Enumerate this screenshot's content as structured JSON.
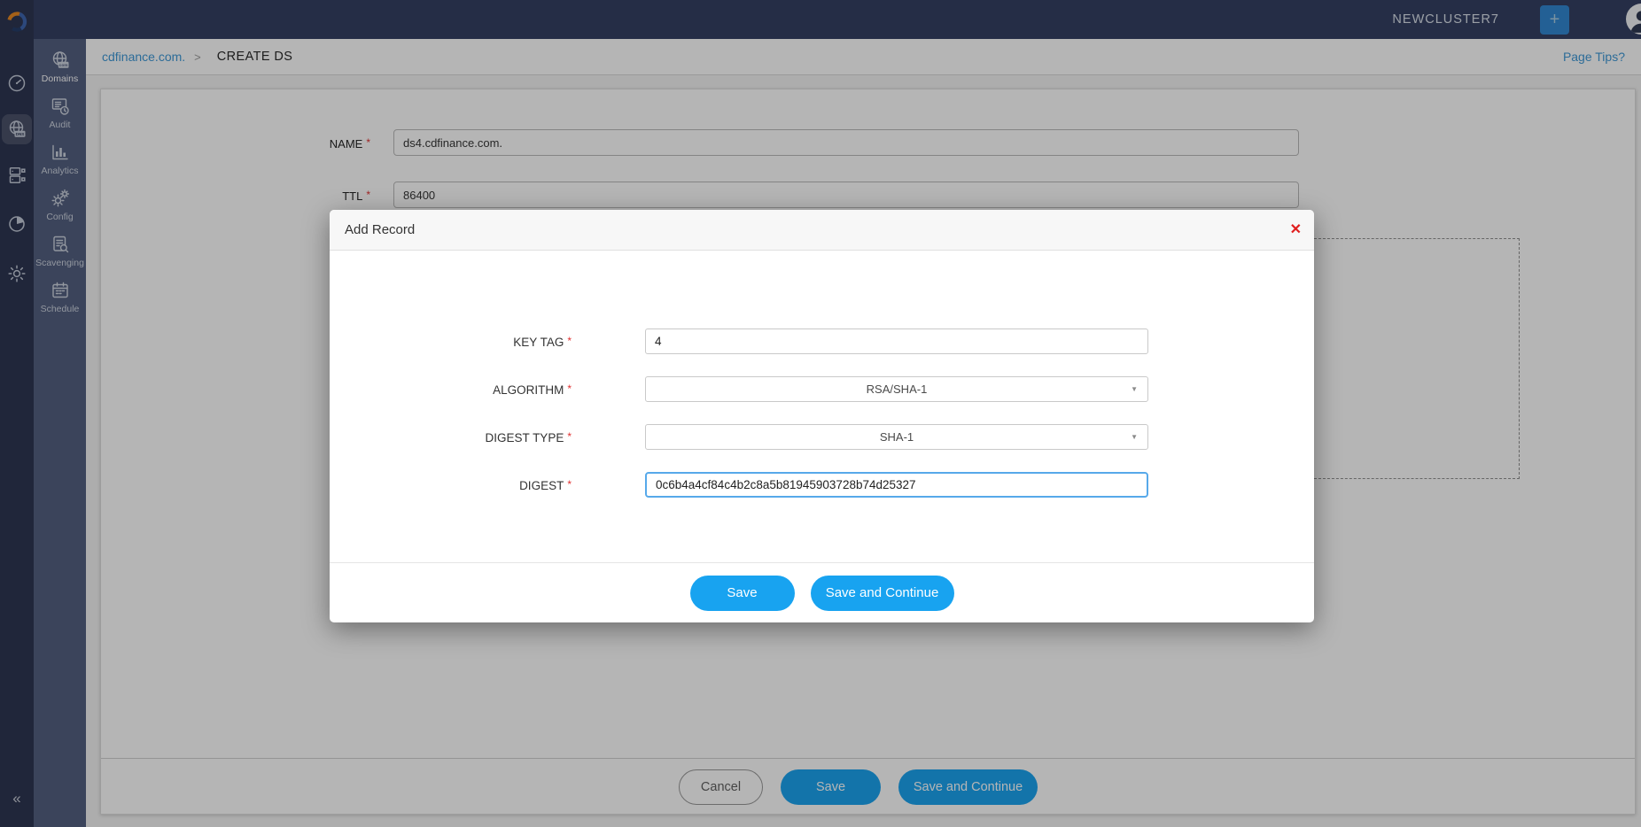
{
  "topbar": {
    "cluster_name": "NEWCLUSTER7",
    "add_button_label": "+",
    "avatar_icon": "user-avatar"
  },
  "sidebar_outer": {
    "logo_icon": "brand-swirl",
    "items": [
      {
        "icon": "dashboard-speedometer",
        "active": false
      },
      {
        "icon": "dns-globe",
        "active": true
      },
      {
        "icon": "server-devices",
        "active": false
      },
      {
        "icon": "pie-chart",
        "active": false
      },
      {
        "icon": "settings-gear",
        "active": false
      }
    ],
    "collapse_glyph": "«"
  },
  "sidebar_inner": {
    "items": [
      {
        "label": "Domains",
        "icon": "globe-com",
        "active": true
      },
      {
        "label": "Audit",
        "icon": "audit-log",
        "active": false
      },
      {
        "label": "Analytics",
        "icon": "bar-chart",
        "active": false
      },
      {
        "label": "Config",
        "icon": "gears",
        "active": false
      },
      {
        "label": "Scavenging",
        "icon": "document-search",
        "active": false
      },
      {
        "label": "Schedule",
        "icon": "calendar",
        "active": false
      }
    ]
  },
  "breadcrumb": {
    "parent": "cdfinance.com.",
    "separator": ">",
    "current": "CREATE DS"
  },
  "page_tips_label": "Page Tips?",
  "page_form": {
    "required_mark": "*",
    "fields": [
      {
        "label": "NAME",
        "value": "ds4.cdfinance.com."
      },
      {
        "label": "TTL",
        "value": "86400"
      }
    ],
    "buttons": {
      "cancel": "Cancel",
      "save": "Save",
      "save_and_continue": "Save and Continue"
    }
  },
  "modal": {
    "title": "Add Record",
    "close_glyph": "✕",
    "required_mark": "*",
    "select_caret_glyph": "▼",
    "fields": [
      {
        "label": "KEY TAG",
        "type": "text",
        "value": "4"
      },
      {
        "label": "ALGORITHM",
        "type": "select",
        "value": "RSA/SHA-1"
      },
      {
        "label": "DIGEST TYPE",
        "type": "select",
        "value": "SHA-1"
      },
      {
        "label": "DIGEST",
        "type": "text",
        "value": "0c6b4a4cf84c4b2c8a5b81945903728b74d25327",
        "focused": true
      }
    ],
    "buttons": {
      "save": "Save",
      "save_and_continue": "Save and Continue"
    }
  },
  "colors": {
    "accent_blue": "#18a3f0",
    "link_blue": "#3c97d6",
    "danger_red": "#e01e1e",
    "topbar_add_blue": "#2e86d1",
    "topbar_bg": "#323d60",
    "sidebar_outer_bg": "#2a3350",
    "sidebar_inner_bg": "#515d7e"
  }
}
